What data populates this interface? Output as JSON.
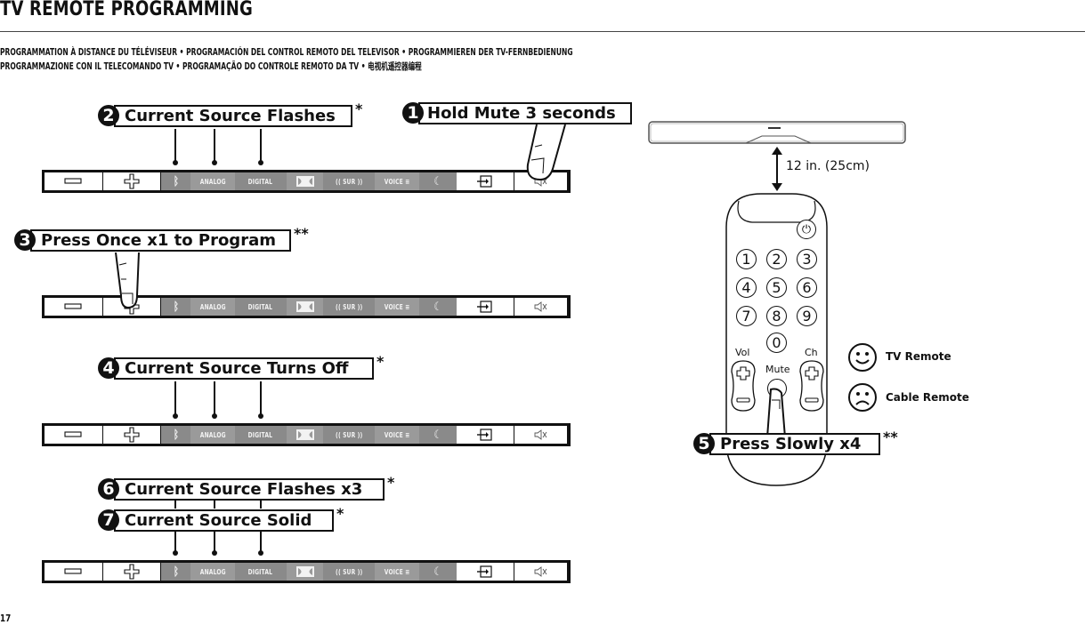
{
  "header": {
    "title": "TV REMOTE PROGRAMMING",
    "subtitle_lines": [
      "PROGRAMMATION À DISTANCE DU TÉLÉVISEUR  •  PROGRAMACIÓN DEL CONTROL REMOTO DEL TELEVISOR  •  PROGRAMMIEREN DER TV-FERNBEDIENUNG",
      "PROGRAMMAZIONE CON IL TELECOMANDO TV  •  PROGRAMAÇÃO DO CONTROLE REMOTO DA TV  •  电视机遥控器编程"
    ]
  },
  "steps": [
    {
      "number": "1",
      "label": "Hold Mute 3 seconds",
      "mark": ""
    },
    {
      "number": "2",
      "label": "Current Source Flashes",
      "mark": "*"
    },
    {
      "number": "3",
      "label": "Press Once x1 to Program",
      "mark": "**"
    },
    {
      "number": "4",
      "label": "Current Source Turns Off",
      "mark": "*"
    },
    {
      "number": "5",
      "label": "Press Slowly x4",
      "mark": "**"
    },
    {
      "number": "6",
      "label": "Current Source Flashes x3",
      "mark": "*"
    },
    {
      "number": "7",
      "label": "Current Source Solid",
      "mark": "*"
    }
  ],
  "panel": {
    "buttons": [
      {
        "id": "volume-down",
        "icon": "minus-icon",
        "label": ""
      },
      {
        "id": "volume-up",
        "icon": "plus-icon",
        "label": ""
      },
      {
        "id": "bluetooth",
        "icon": "bluetooth-icon",
        "label": "ᛒ"
      },
      {
        "id": "analog",
        "icon": "",
        "label": "ANALOG"
      },
      {
        "id": "digital",
        "icon": "",
        "label": "DIGITAL"
      },
      {
        "id": "dolby",
        "icon": "dolby-icon",
        "label": ""
      },
      {
        "id": "surround",
        "icon": "",
        "label": "(( SUR ))"
      },
      {
        "id": "voice",
        "icon": "",
        "label": "VOICE ≡"
      },
      {
        "id": "night",
        "icon": "moon-icon",
        "label": "☾"
      },
      {
        "id": "input",
        "icon": "input-icon",
        "label": ""
      },
      {
        "id": "mute",
        "icon": "mute-icon",
        "label": ""
      }
    ]
  },
  "soundbar": {
    "distance_label": "12 in. (25cm)"
  },
  "remote": {
    "keys": [
      "1",
      "2",
      "3",
      "4",
      "5",
      "6",
      "7",
      "8",
      "9",
      "0"
    ],
    "vol_label": "Vol",
    "ch_label": "Ch",
    "mute_label": "Mute"
  },
  "legend": {
    "tv_remote": "TV Remote",
    "cable_remote": "Cable Remote"
  },
  "footer": {
    "page_number": "17"
  }
}
